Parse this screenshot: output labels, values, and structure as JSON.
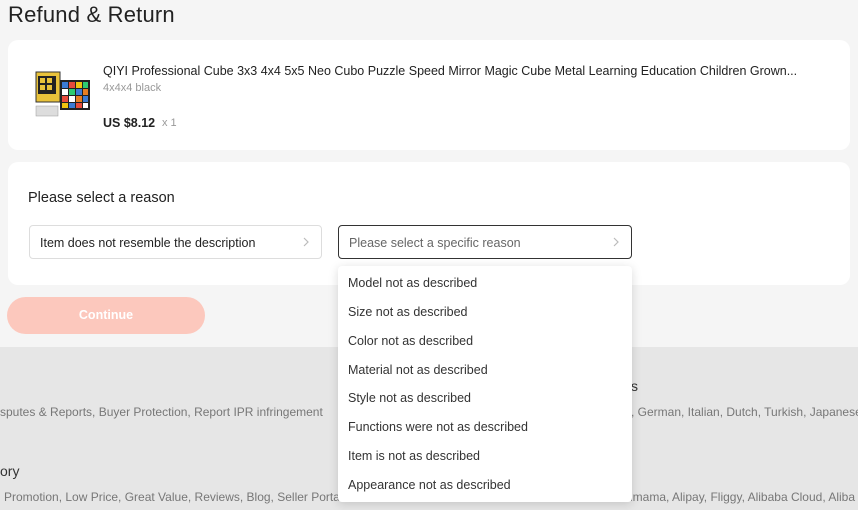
{
  "page": {
    "title": "Refund & Return"
  },
  "product": {
    "title": "QIYI Professional Cube 3x3 4x4 5x5 Neo Cubo Puzzle Speed Mirror Magic Cube Metal Learning Education Children Grown...",
    "variant": "4x4x4 black",
    "price": "US $8.12",
    "quantity": "x 1"
  },
  "reason": {
    "heading": "Please select a reason",
    "main_value": "Item does not resemble the description",
    "specific_placeholder": "Please select a specific reason",
    "options": [
      "Model not as described",
      "Size not as described",
      "Color not as described",
      "Material not as described",
      "Style not as described",
      "Functions were not as described",
      "Item is not as described",
      "Appearance not as described"
    ]
  },
  "actions": {
    "continue_label": "Continue"
  },
  "footer": {
    "heading_right_fragment": "s",
    "row1_left": "sputes & Reports, Buyer Protection, Report IPR infringement",
    "row1_right": ", German, Italian, Dutch, Turkish, Japanese",
    "heading_left_fragment": "ory",
    "row2_left": "Promotion, Low Price, Great Value, Reviews, Blog, Seller Portal",
    "row2_right": "imama, Alipay, Fliggy, Alibaba Cloud, Aliba"
  },
  "colors": {
    "accent_disabled": "#fcc8bd",
    "page_bg": "#f5f5f5",
    "footer_bg": "#e6e6e6"
  }
}
